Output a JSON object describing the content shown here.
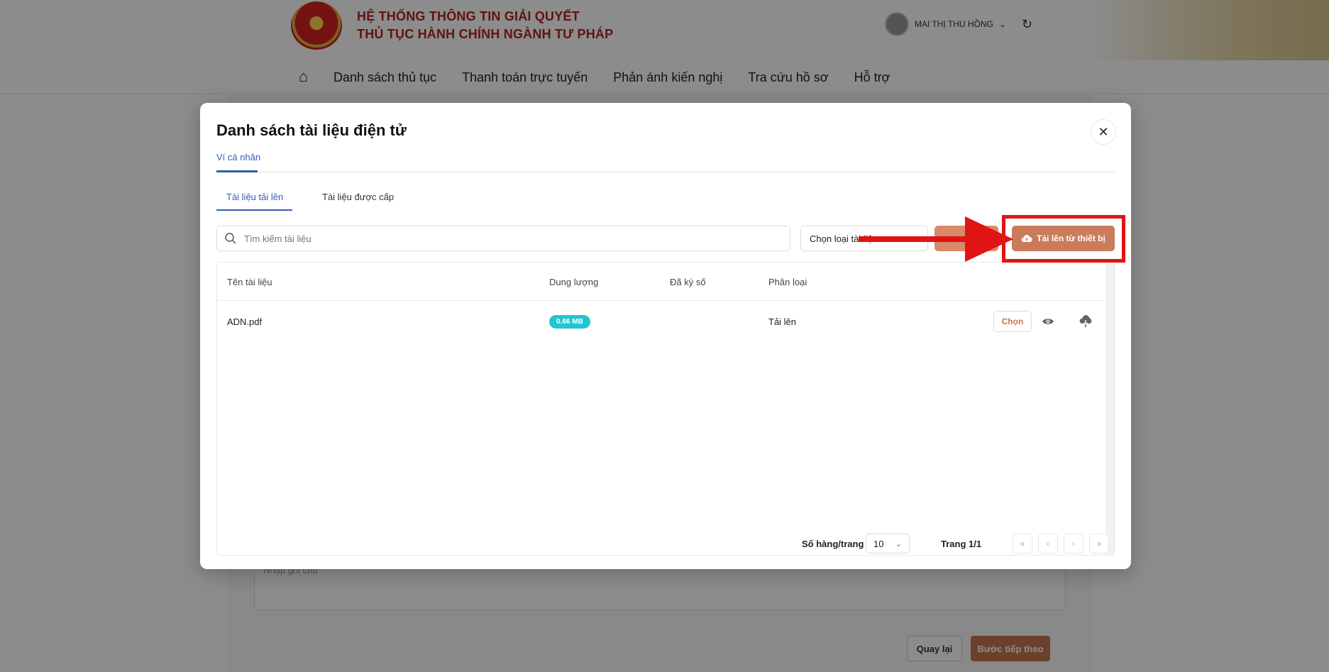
{
  "background": {
    "system_title_line1": "HỆ THỐNG THÔNG TIN GIẢI QUYẾT",
    "system_title_line2": "THỦ TỤC HÀNH CHÍNH NGÀNH TƯ PHÁP",
    "user_name": "MAI THỊ THU HỒNG",
    "nav": [
      "Danh sách thủ tục",
      "Thanh toán trực tuyến",
      "Phản ánh kiến nghị",
      "Tra cứu hồ sơ",
      "Hỗ trợ"
    ],
    "textarea_placeholder": "Nhập ghi chú",
    "back_button": "Quay lại",
    "next_button": "Bước tiếp theo"
  },
  "modal": {
    "title": "Danh sách tài liệu điện tử",
    "top_tab": "Ví cá nhân",
    "tabs": [
      "Tài liệu tải lên",
      "Tài liệu được cấp"
    ],
    "search_placeholder": "Tìm kiếm tài liệu",
    "type_select": "Chọn loại tài liệu",
    "upload_button": "Tải lên từ thiết bị",
    "columns": [
      "Tên tài liệu",
      "Dung lượng",
      "Đã ký số",
      "Phân loại"
    ],
    "rows": [
      {
        "name": "ADN.pdf",
        "size": "0.66 MB",
        "signed": "",
        "category": "Tải lên",
        "choose": "Chọn"
      }
    ],
    "pagination": {
      "rows_per_page_label": "Số hàng/trang",
      "rows_per_page": "10",
      "page_info": "Trang 1/1"
    }
  },
  "colors": {
    "accent": "#c97b5a",
    "tab_active": "#2f5db8",
    "badge": "#23c4cf",
    "annotation": "#e01414"
  }
}
